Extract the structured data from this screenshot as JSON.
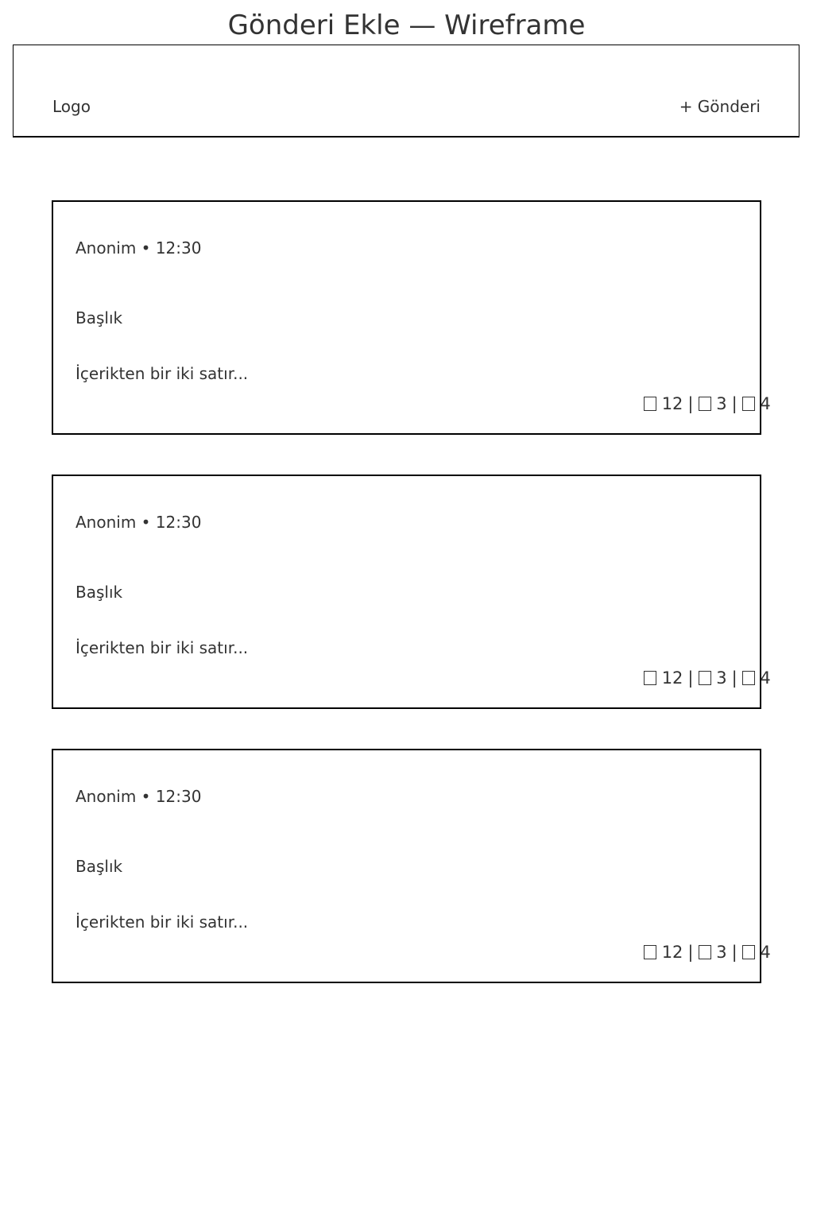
{
  "page": {
    "title": "Gönderi Ekle — Wireframe"
  },
  "header": {
    "logo": "Logo",
    "new_post_label": "+ Gönderi"
  },
  "posts": [
    {
      "meta": "Anonim • 12:30",
      "title": "Başlık",
      "excerpt": "İçerikten bir iki satır...",
      "stats": {
        "likes": "12",
        "likes_icon": "like-icon",
        "comments": "3",
        "comments_icon": "comment-icon",
        "shares": "4",
        "shares_icon": "share-icon",
        "separator": "|"
      }
    },
    {
      "meta": "Anonim • 12:30",
      "title": "Başlık",
      "excerpt": "İçerikten bir iki satır...",
      "stats": {
        "likes": "12",
        "likes_icon": "like-icon",
        "comments": "3",
        "comments_icon": "comment-icon",
        "shares": "4",
        "shares_icon": "share-icon",
        "separator": "|"
      }
    },
    {
      "meta": "Anonim • 12:30",
      "title": "Başlık",
      "excerpt": "İçerikten bir iki satır...",
      "stats": {
        "likes": "12",
        "likes_icon": "like-icon",
        "comments": "3",
        "comments_icon": "comment-icon",
        "shares": "4",
        "shares_icon": "share-icon",
        "separator": "|"
      }
    }
  ],
  "colors": {
    "text": "#333333",
    "border": "#000000",
    "background": "#ffffff"
  }
}
